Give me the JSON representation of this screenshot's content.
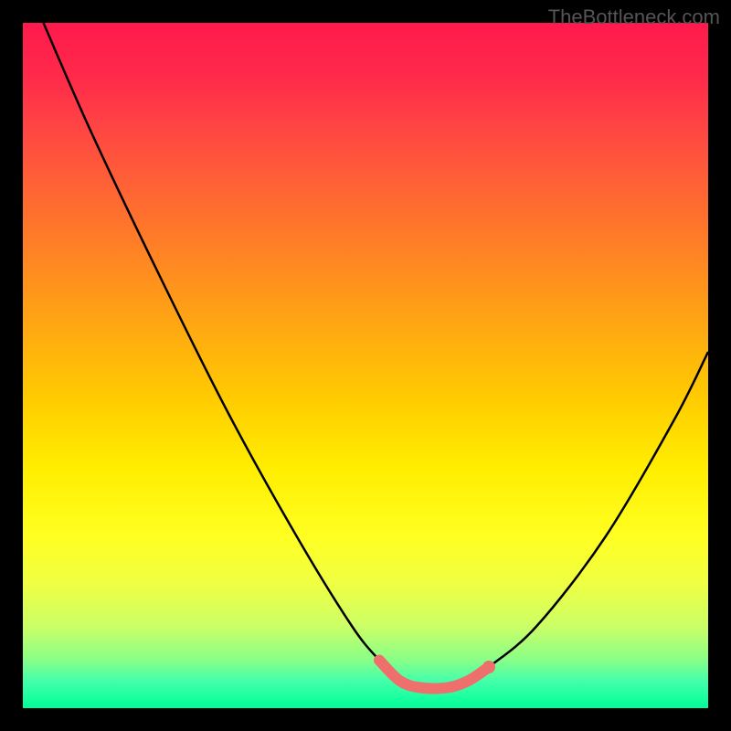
{
  "watermark": "TheBottleneck.com",
  "chart_data": {
    "type": "line",
    "title": "",
    "xlabel": "",
    "ylabel": "",
    "xlim": [
      0,
      100
    ],
    "ylim": [
      0,
      100
    ],
    "series": [
      {
        "name": "bottleneck-curve",
        "x": [
          3,
          10,
          20,
          30,
          40,
          48,
          52,
          55,
          58,
          62,
          65,
          68,
          75,
          85,
          95,
          100
        ],
        "values": [
          100,
          84,
          63,
          43,
          25,
          12,
          7,
          4,
          3,
          3,
          4,
          6,
          12,
          25,
          42,
          52
        ]
      }
    ],
    "highlight": {
      "name": "optimal-range",
      "x": [
        52,
        55,
        58,
        62,
        65,
        68
      ],
      "values": [
        7,
        4,
        3,
        3,
        4,
        6
      ],
      "color": "#ef6f6c"
    },
    "gradient_stops": [
      {
        "pos": 0,
        "color": "#ff1a4d"
      },
      {
        "pos": 25,
        "color": "#ff6633"
      },
      {
        "pos": 50,
        "color": "#ffcc00"
      },
      {
        "pos": 75,
        "color": "#ffff22"
      },
      {
        "pos": 100,
        "color": "#00ff99"
      }
    ]
  }
}
